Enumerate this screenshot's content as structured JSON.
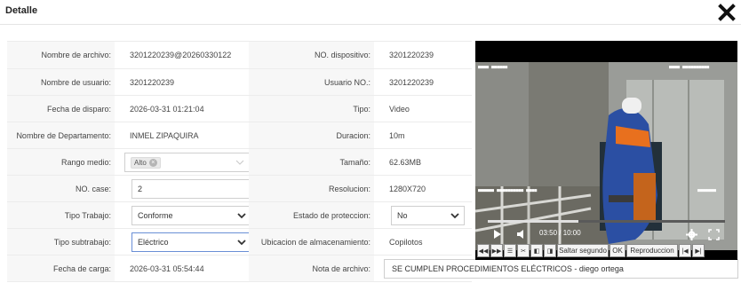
{
  "header": {
    "title": "Detalle"
  },
  "details": {
    "file_name_label": "Nombre de archivo:",
    "file_name_value": "3201220239@20260330122",
    "device_no_label": "NO. dispositivo:",
    "device_no_value": "3201220239",
    "user_name_label": "Nombre de usuario:",
    "user_name_value": "3201220239",
    "user_no_label": "Usuario NO.:",
    "user_no_value": "3201220239",
    "trigger_date_label": "Fecha de disparo:",
    "trigger_date_value": "2026-03-31 01:21:04",
    "type_label": "Tipo:",
    "type_value": "Video",
    "department_label": "Nombre de Departamento:",
    "department_value": "INMEL ZIPAQUIRA",
    "duration_label": "Duracion:",
    "duration_value": "10m",
    "range_label": "Rango medio:",
    "range_tag": "Alto",
    "size_label": "Tamaño:",
    "size_value": "62.63MB",
    "case_no_label": "NO. case:",
    "case_no_value": "2",
    "resolution_label": "Resolucion:",
    "resolution_value": "1280X720",
    "work_type_label": "Tipo Trabajo:",
    "work_type_value": "Conforme",
    "protection_label": "Estado de proteccion:",
    "protection_value": "No",
    "subwork_type_label": "Tipo subtrabajo:",
    "subwork_type_value": "Eléctrico",
    "storage_label": "Ubicacion de almacenamiento:",
    "storage_value": "Copilotos",
    "upload_date_label": "Fecha de carga:",
    "upload_date_value": "2026-03-31 05:54:44",
    "file_note_label": "Nota de archivo:",
    "file_note_value": "SE CUMPLEN PROCEDIMIENTOS ELÉCTRICOS - diego ortega"
  },
  "player": {
    "time_display": "03:50 / 10:00",
    "progress_fraction": 0.383
  },
  "toolbar": {
    "skip_label": "Saltar segundo",
    "ok_label": "OK",
    "playback_label": "Reproduccion"
  },
  "colors": {
    "label_bg": "#f7f7f7",
    "border": "#ececec",
    "focus_border": "#6a8fd6",
    "player_bg": "#000000"
  }
}
